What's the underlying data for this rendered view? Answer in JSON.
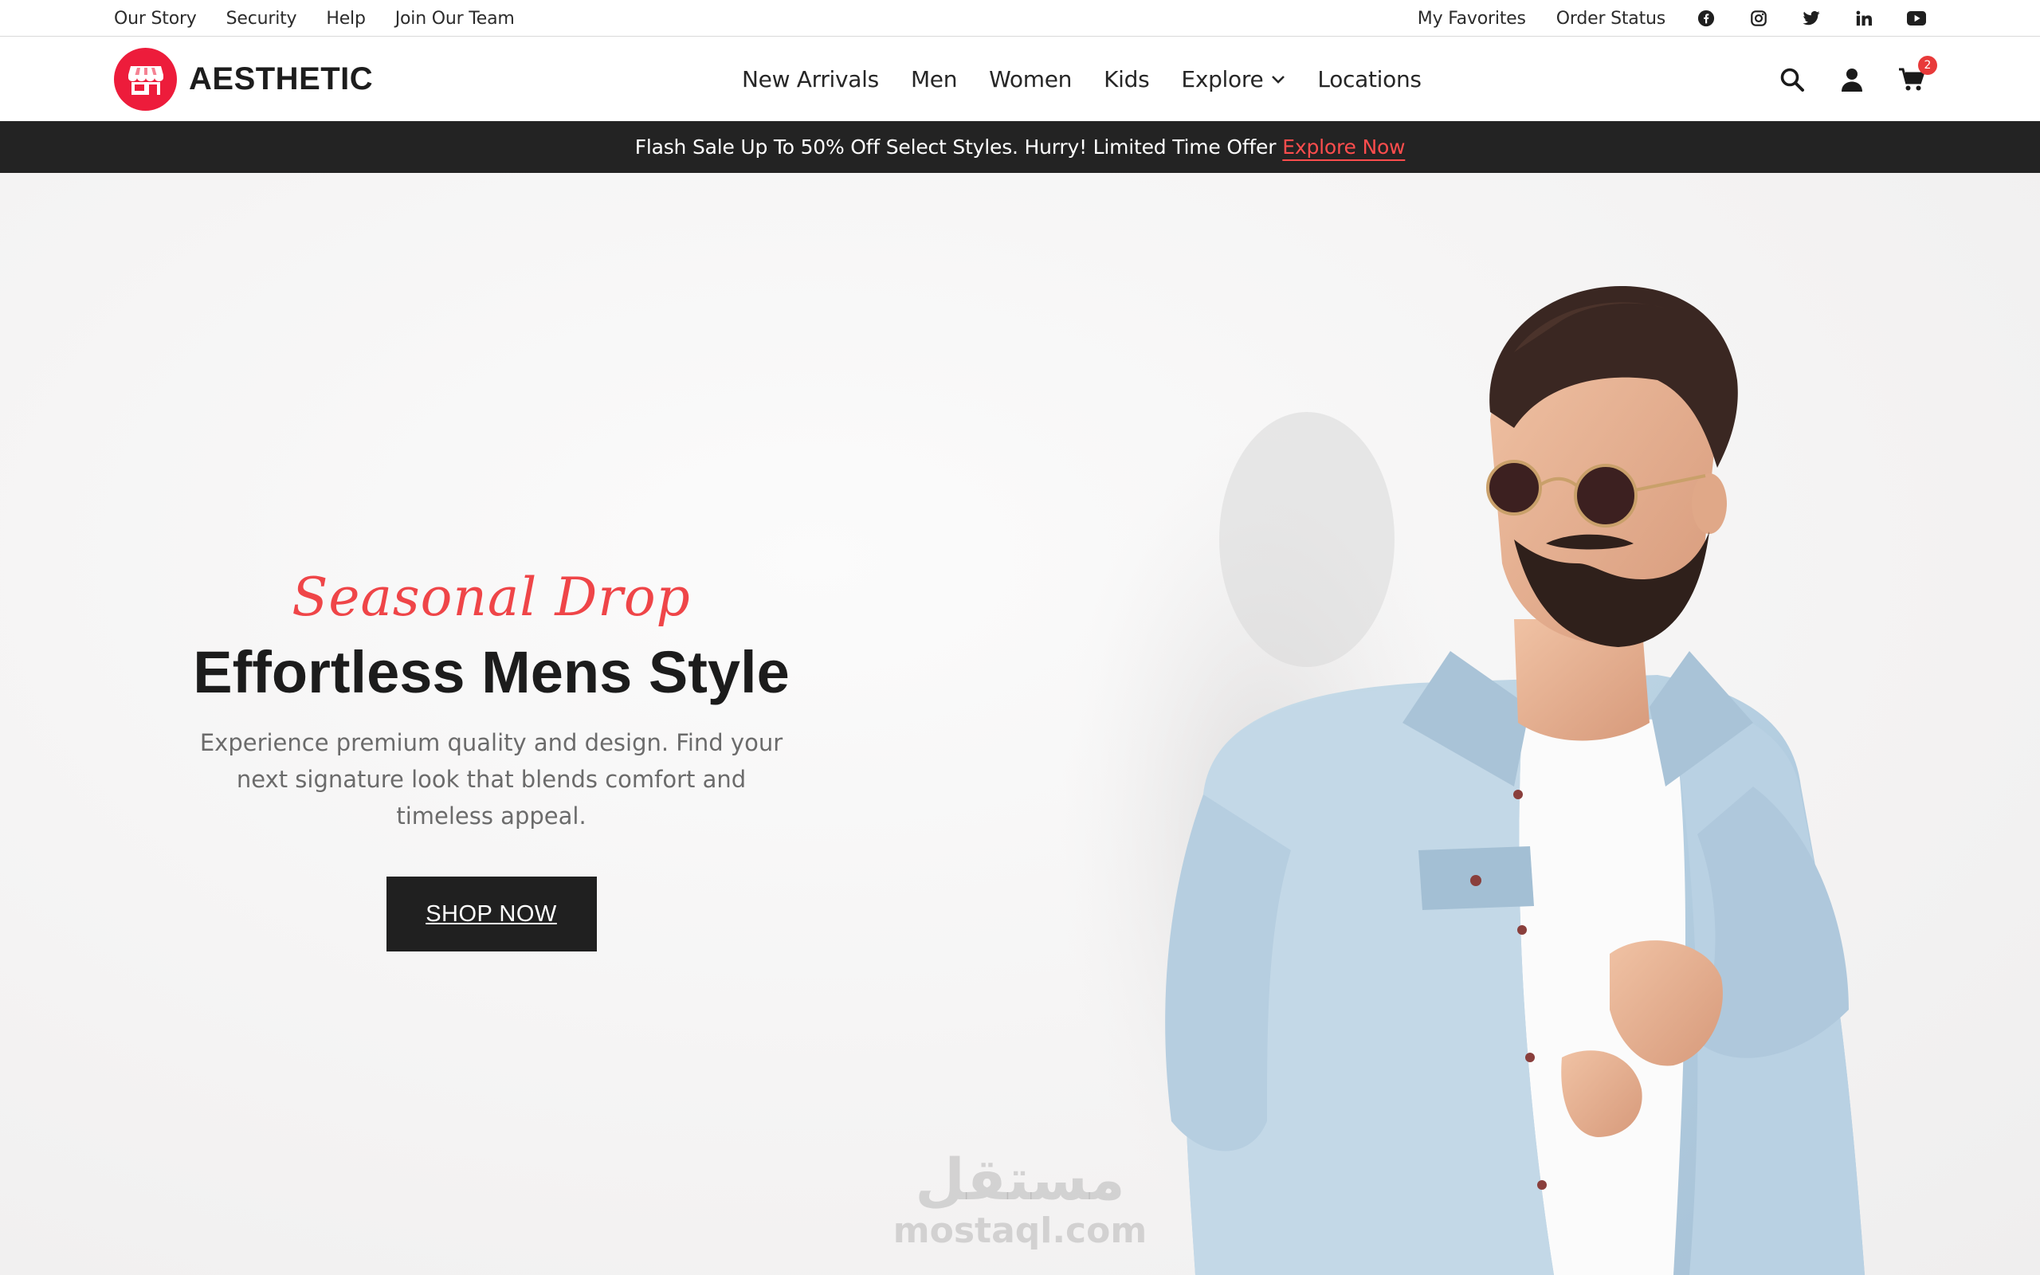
{
  "topbar": {
    "left_links": [
      "Our Story",
      "Security",
      "Help",
      "Join Our Team"
    ],
    "right_links": [
      "My Favorites",
      "Order Status"
    ],
    "social_icons": [
      "facebook-icon",
      "instagram-icon",
      "twitter-icon",
      "linkedin-icon",
      "youtube-icon"
    ]
  },
  "header": {
    "brand": "AESTHETIC",
    "brand_color": "#ed1c3b",
    "nav": [
      "New Arrivals",
      "Men",
      "Women",
      "Kids",
      "Explore",
      "Locations"
    ],
    "cart_count": "2"
  },
  "promo": {
    "text": "Flash Sale Up To 50% Off Select Styles. Hurry! Limited Time Offer",
    "link": "Explore Now",
    "link_color": "#ff4d4d"
  },
  "hero": {
    "script": "Seasonal Drop",
    "title": "Effortless Mens Style",
    "description": "Experience premium quality and design. Find your next signature look that blends comfort and timeless appeal.",
    "cta": "SHOP NOW"
  },
  "watermark": {
    "arabic": "مستقل",
    "latin": "mostaql.com"
  }
}
